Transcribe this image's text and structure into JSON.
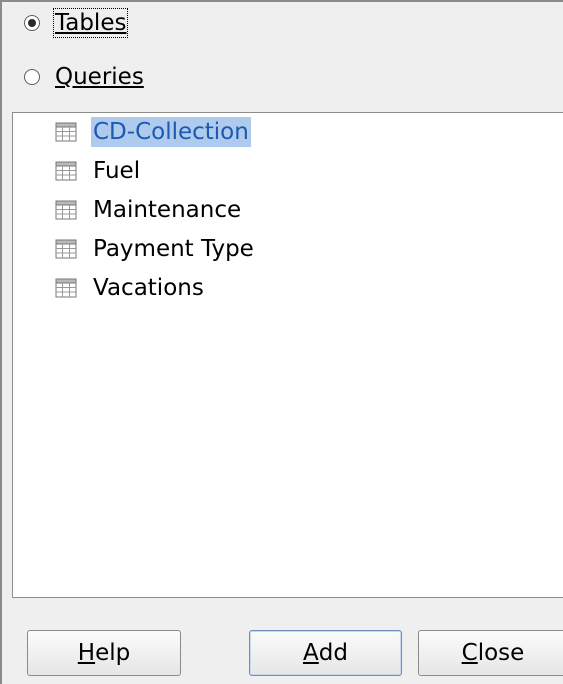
{
  "source_type": {
    "tables_label": "Tables",
    "queries_label": "Queries",
    "selected": "tables"
  },
  "list": {
    "items": [
      {
        "label": "CD-Collection",
        "selected": true,
        "icon": "table-icon"
      },
      {
        "label": "Fuel",
        "selected": false,
        "icon": "table-icon"
      },
      {
        "label": "Maintenance",
        "selected": false,
        "icon": "table-icon"
      },
      {
        "label": "Payment Type",
        "selected": false,
        "icon": "table-icon"
      },
      {
        "label": "Vacations",
        "selected": false,
        "icon": "table-icon"
      }
    ]
  },
  "buttons": {
    "help_mnemonic": "H",
    "help_rest": "elp",
    "add_mnemonic": "A",
    "add_rest": "dd",
    "close_mnemonic": "C",
    "close_rest": "lose"
  },
  "colors": {
    "selection_bg": "#aecbee",
    "selection_text": "#1e58b0",
    "dialog_bg": "#efefef"
  }
}
